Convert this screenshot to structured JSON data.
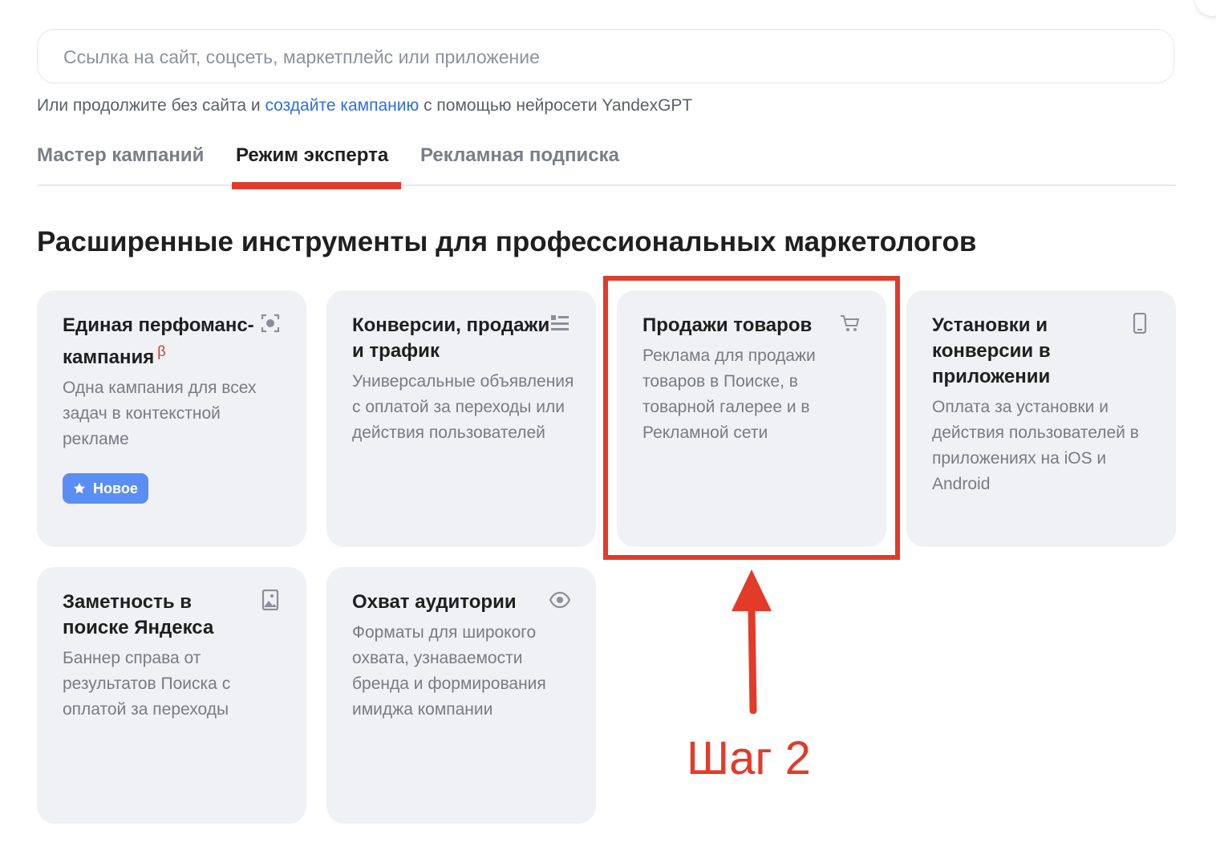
{
  "search": {
    "placeholder": "Ссылка на сайт, соцсеть, маркетплейс или приложение"
  },
  "hint": {
    "prefix": "Или продолжите без сайта и ",
    "link": "создайте кампанию",
    "suffix": " с помощью нейросети YandexGPT"
  },
  "tabs": [
    {
      "label": "Мастер кампаний",
      "active": false
    },
    {
      "label": "Режим эксперта",
      "active": true
    },
    {
      "label": "Рекламная подписка",
      "active": false
    }
  ],
  "heading": "Расширенные инструменты для профессиональных маркетологов",
  "cards": [
    {
      "title": "Единая перфоманс-кампания",
      "beta": "β",
      "desc": "Одна кампания для всех задач в контекстной рекламе",
      "badge": "Новое",
      "icon": "focus-target-icon"
    },
    {
      "title": "Конверсии, продажи и трафик",
      "desc": "Универсальные объявления с оплатой за переходы или действия пользователей",
      "icon": "list-icon"
    },
    {
      "title": "Продажи товаров",
      "desc": "Реклама для продажи товаров в Поиске, в товарной галерее и в Рекламной сети",
      "icon": "cart-icon"
    },
    {
      "title": "Установки и конверсии в приложении",
      "desc": "Оплата за установки и действия пользователей в приложениях на iOS и Android",
      "icon": "phone-icon"
    },
    {
      "title": "Заметность в поиске Яндекса",
      "desc": "Баннер справа от результатов Поиска с оплатой за переходы",
      "icon": "image-icon"
    },
    {
      "title": "Охват аудитории",
      "desc": "Форматы для широкого охвата, узнаваемости бренда и формирования имиджа компании",
      "icon": "eye-icon"
    }
  ],
  "annotation": {
    "label": "Шаг 2",
    "color": "#e23b2a"
  },
  "colors": {
    "accent_link": "#2f6fe4",
    "card_bg": "#f0f1f4",
    "badge_bg": "#5b8ef2"
  }
}
